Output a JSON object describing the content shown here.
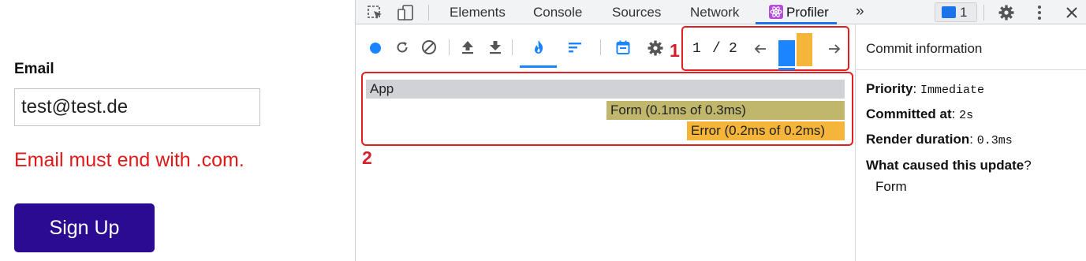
{
  "app": {
    "email_label": "Email",
    "email_value": "test@test.de",
    "error_message": "Email must end with .com.",
    "signup_label": "Sign Up"
  },
  "devtools": {
    "tabs": [
      "Elements",
      "Console",
      "Sources",
      "Network",
      "Profiler"
    ],
    "active_tab": "Profiler",
    "more_tabs": "»",
    "message_count": "1",
    "profiler": {
      "commit_current": "1",
      "commit_separator": "/",
      "commit_total": "2",
      "flame": [
        {
          "label": "App",
          "color": "#d1d2d6"
        },
        {
          "label": "Form (0.1ms of 0.3ms)",
          "color": "#c0b76d"
        },
        {
          "label": "Error (0.2ms of 0.2ms)",
          "color": "#f5b53a"
        }
      ],
      "commit_bar_colors": [
        "#1a85ff",
        "#f5b53a"
      ],
      "callouts": [
        "1",
        "2"
      ]
    },
    "commit_info": {
      "title": "Commit information",
      "priority_label": "Priority",
      "priority_value": "Immediate",
      "committed_label": "Committed at",
      "committed_value": "2s",
      "render_label": "Render duration",
      "render_value": "0.3ms",
      "cause_label": "What caused this update",
      "cause_value": "Form"
    }
  }
}
